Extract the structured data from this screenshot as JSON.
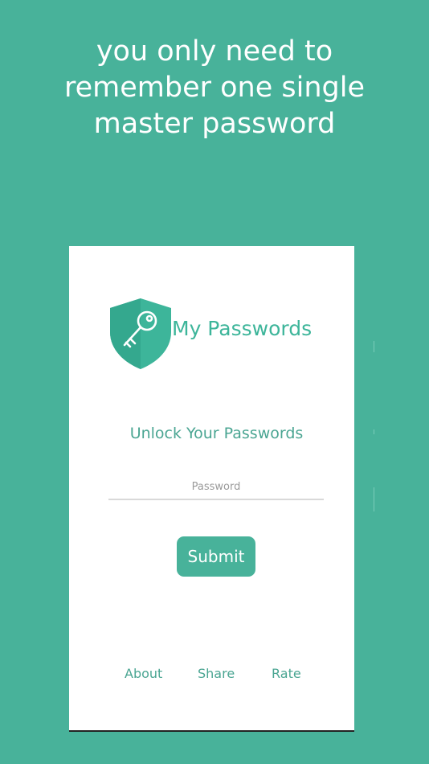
{
  "headline": {
    "line1": "you only need to",
    "line2": "remember one single",
    "line3": "master password"
  },
  "card": {
    "logo_icon": "shield-key-icon",
    "app_name": "My Passwords",
    "unlock_title": "Unlock Your Passwords",
    "password_placeholder": "Password",
    "submit_label": "Submit",
    "footer_links": {
      "about": "About",
      "share": "Share",
      "rate": "Rate"
    }
  },
  "colors": {
    "background": "#48B29A",
    "accent": "#3DB59A",
    "card": "#FFFFFF"
  }
}
